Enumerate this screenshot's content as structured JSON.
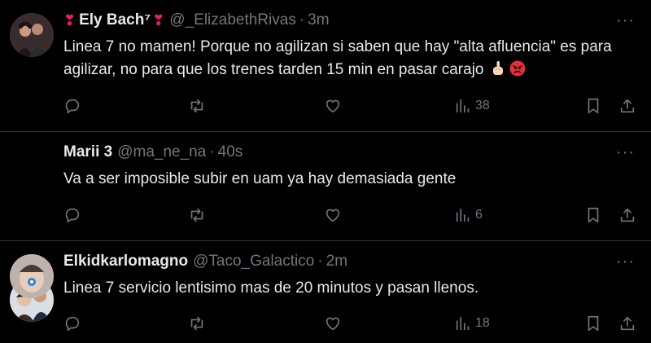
{
  "tweets": [
    {
      "name": "Ely Bach⁷",
      "name_prefix_emoji": "❣",
      "name_suffix_emoji": "❣",
      "handle": "@_ElizabethRivas",
      "time": "3m",
      "text": "Linea 7 no mamen! Porque no agilizan si saben que hay \"alta afluencia\" es para agilizar, no para que los trenes tarden 15 min en pasar carajo",
      "views": "38"
    },
    {
      "name": "Marii 3",
      "handle": "@ma_ne_na",
      "time": "40s",
      "text": "Va a ser imposible subir en uam ya hay demasiada gente",
      "views": "6"
    },
    {
      "name": "Elkidkarlomagno",
      "handle": "@Taco_Galactico",
      "time": "2m",
      "text": "Linea 7 servicio lentisimo mas de 20 minutos y pasan llenos.",
      "views": "18"
    }
  ],
  "separator": "·",
  "more_label": "···",
  "icons": [
    "reply-icon",
    "retweet-icon",
    "like-icon",
    "views-icon",
    "bookmark-icon",
    "share-icon"
  ]
}
